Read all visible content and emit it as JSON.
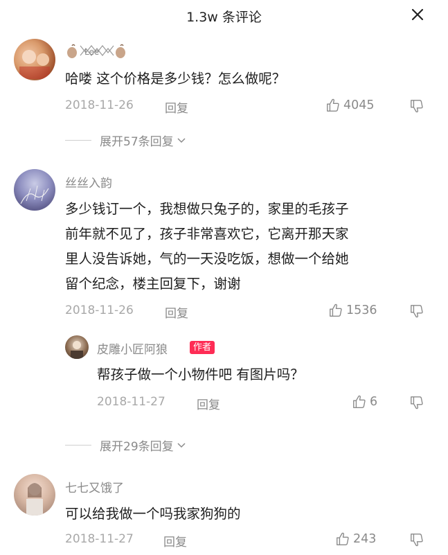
{
  "header": {
    "title": "1.3w 条评论"
  },
  "comments": [
    {
      "username": "",
      "content_lines": [
        "哈喽 这个价格是多少钱？怎么做呢？"
      ],
      "date": "2018-11-26",
      "reply_label": "回复",
      "likes": "4045",
      "expand_label": "展开57条回复"
    },
    {
      "username": "丝丝入韵",
      "content_lines": [
        "多少钱订一个，我想做只兔子的，家里的毛孩子",
        "前年就不见了，孩子非常喜欢它，它离开那天家",
        "里人没告诉她，气的一天没吃饭，想做一个给她",
        "留个纪念，楼主回复下，谢谢"
      ],
      "date": "2018-11-26",
      "reply_label": "回复",
      "likes": "1536",
      "reply": {
        "username": "皮雕小匠阿狼",
        "badge": "作者",
        "content": "帮孩子做一个小物件吧 有图片吗？",
        "date": "2018-11-27",
        "reply_label": "回复",
        "likes": "6"
      },
      "expand_label": "展开29条回复"
    },
    {
      "username": "七七又饿了",
      "content_lines": [
        "可以给我做一个吗我家狗狗的"
      ],
      "date": "2018-11-27",
      "reply_label": "回复",
      "likes": "243"
    }
  ]
}
